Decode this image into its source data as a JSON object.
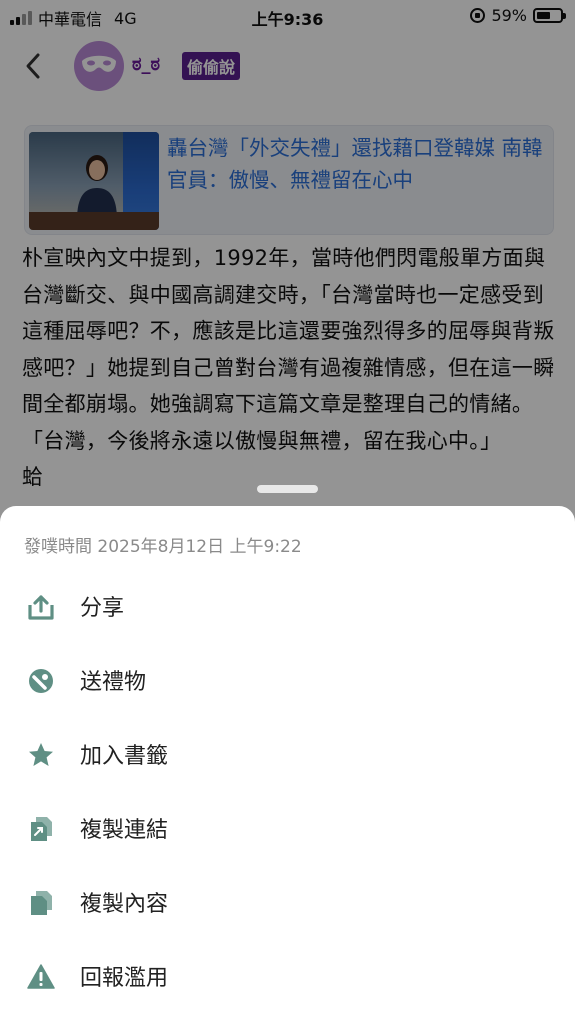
{
  "status_bar": {
    "carrier": "中華電信",
    "network": "4G",
    "time": "上午9:36",
    "battery": "59%",
    "battery_level": 0.59
  },
  "header": {
    "username": "ಠ_ಠ",
    "badge": "偷偷說"
  },
  "link_card": {
    "title": "轟台灣「外交失禮」還找藉口登韓媒 南韓官員：傲慢、無禮留在心中"
  },
  "post_body": {
    "text": "朴宣映內文中提到，1992年，當時他們閃電般單方面與台灣斷交、與中國高調建交時，「台灣當時也一定感受到這種屈辱吧？不，應該是比這還要強烈得多的屈辱與背叛感吧？」她提到自己曾對台灣有過複雜情感，但在這一瞬間全都崩塌。她強調寫下這篇文章是整理自己的情緒。「台灣，今後將永遠以傲慢與無禮，留在我心中。」",
    "trailing": "蛤"
  },
  "sheet": {
    "post_time": "發噗時間 2025年8月12日 上午9:22",
    "items": [
      {
        "label": "分享",
        "icon": "share-icon"
      },
      {
        "label": "送禮物",
        "icon": "gift-icon"
      },
      {
        "label": "加入書籤",
        "icon": "star-icon"
      },
      {
        "label": "複製連結",
        "icon": "copy-link-icon"
      },
      {
        "label": "複製內容",
        "icon": "copy-content-icon"
      },
      {
        "label": "回報濫用",
        "icon": "warning-icon"
      }
    ],
    "icon_color": "#5f8f84"
  }
}
